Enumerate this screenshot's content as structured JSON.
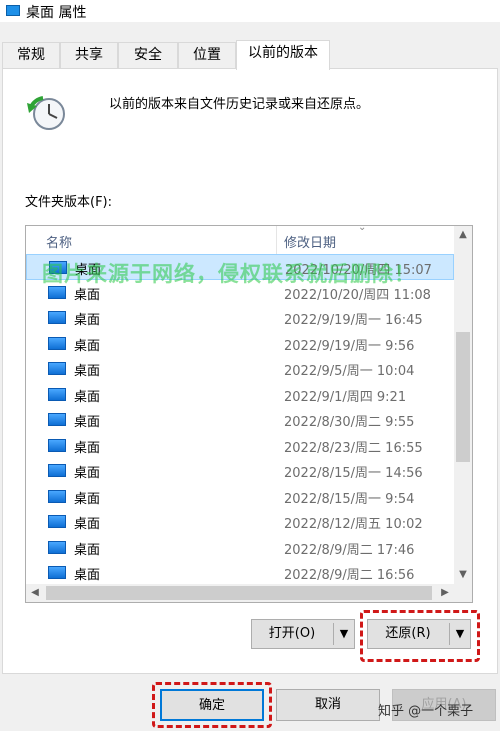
{
  "window": {
    "title": "桌面 属性"
  },
  "tabs": [
    {
      "label": "常规",
      "active": false
    },
    {
      "label": "共享",
      "active": false
    },
    {
      "label": "安全",
      "active": false
    },
    {
      "label": "位置",
      "active": false
    },
    {
      "label": "以前的版本",
      "active": true
    }
  ],
  "panel": {
    "description": "以前的版本来自文件历史记录或来自还原点。",
    "section_label": "文件夹版本(F):"
  },
  "list": {
    "columns": {
      "name": "名称",
      "date": "修改日期"
    },
    "rows": [
      {
        "name": "桌面",
        "date": "2022/10/20/周四 15:07"
      },
      {
        "name": "桌面",
        "date": "2022/10/20/周四 11:08"
      },
      {
        "name": "桌面",
        "date": "2022/9/19/周一 16:45"
      },
      {
        "name": "桌面",
        "date": "2022/9/19/周一 9:56"
      },
      {
        "name": "桌面",
        "date": "2022/9/5/周一 10:04"
      },
      {
        "name": "桌面",
        "date": "2022/9/1/周四 9:21"
      },
      {
        "name": "桌面",
        "date": "2022/8/30/周二 9:55"
      },
      {
        "name": "桌面",
        "date": "2022/8/23/周二 16:55"
      },
      {
        "name": "桌面",
        "date": "2022/8/15/周一 14:56"
      },
      {
        "name": "桌面",
        "date": "2022/8/15/周一 9:54"
      },
      {
        "name": "桌面",
        "date": "2022/8/12/周五 10:02"
      },
      {
        "name": "桌面",
        "date": "2022/8/9/周二 17:46"
      },
      {
        "name": "桌面",
        "date": "2022/8/9/周二 16:56"
      }
    ]
  },
  "watermark": "图片来源于网络，侵权联系就后删除！",
  "actions": {
    "open": "打开(O)",
    "restore": "还原(R)"
  },
  "footer": {
    "ok": "确定",
    "cancel": "取消",
    "apply": "应用(A)"
  },
  "credit": "知乎 @一个栗子",
  "colors": {
    "highlight": "#d01818",
    "selection": "#cce8ff",
    "accent": "#0078d7",
    "watermark": "#28c846"
  }
}
